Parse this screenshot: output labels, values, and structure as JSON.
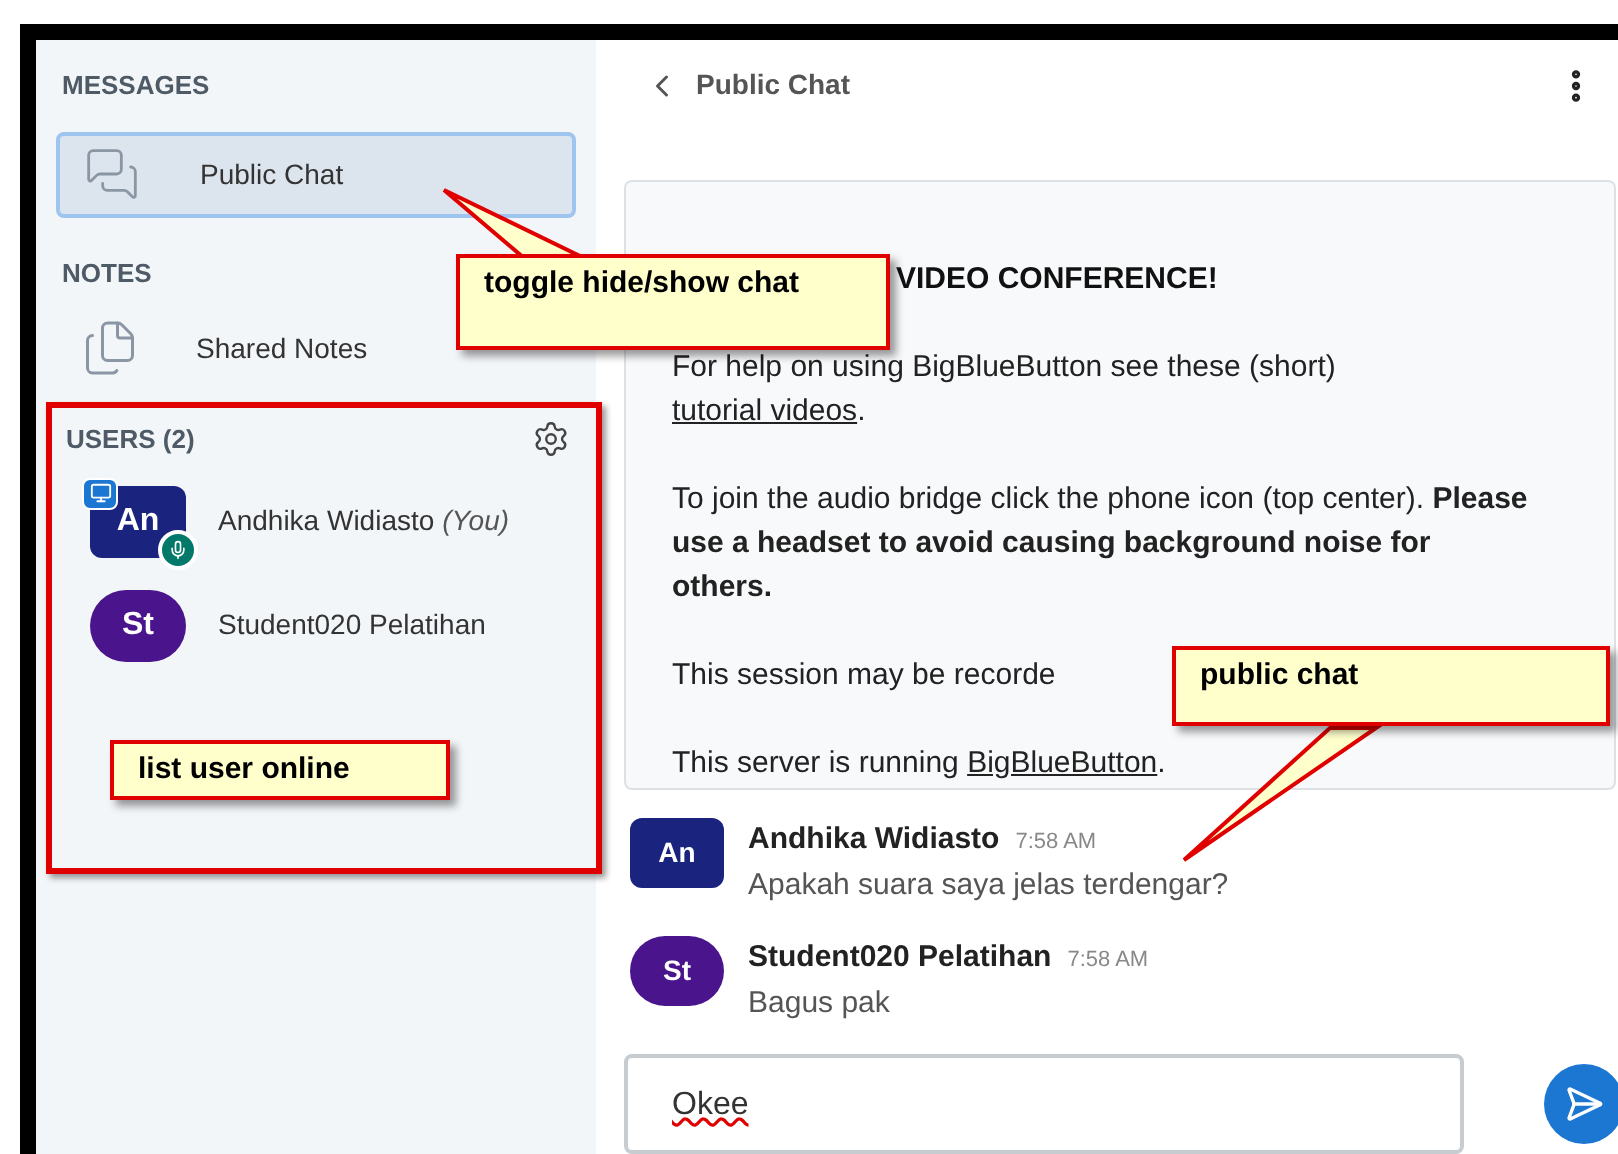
{
  "sidebar": {
    "messages_heading": "MESSAGES",
    "messages": [
      {
        "label": "Public Chat",
        "selected": true
      }
    ],
    "notes_heading": "NOTES",
    "notes": [
      {
        "label": "Shared Notes",
        "selected": false
      }
    ],
    "users_heading": "USERS (2)",
    "users": [
      {
        "initials": "An",
        "name": "Andhika Widiasto",
        "suffix": "(You)",
        "kind": "square",
        "color": "#1a237e",
        "presenter": true,
        "audio": true
      },
      {
        "initials": "St",
        "name": "Student020 Pelatihan",
        "kind": "round",
        "color": "#4a148c",
        "presenter": false,
        "audio": false
      }
    ]
  },
  "chat": {
    "title": "Public Chat",
    "welcome": {
      "title": "VIDEO CONFERENCE!",
      "paragraphs": [
        {
          "parts": [
            {
              "kind": "text",
              "text": "For help on using BigBlueButton see these (short) "
            },
            {
              "kind": "link",
              "text": "tutorial videos"
            },
            {
              "kind": "text",
              "text": "."
            }
          ]
        },
        {
          "parts": [
            {
              "kind": "text",
              "text": "To join the audio bridge click the phone icon (top center). "
            },
            {
              "kind": "bold",
              "text": "Please use a headset to avoid causing background noise for others."
            }
          ]
        },
        {
          "parts": [
            {
              "kind": "text",
              "text": "This session may be recorde"
            }
          ]
        },
        {
          "parts": [
            {
              "kind": "text",
              "text": "This server is running "
            },
            {
              "kind": "link",
              "text": "BigBlueButton"
            },
            {
              "kind": "text",
              "text": "."
            }
          ]
        }
      ]
    },
    "messages": [
      {
        "initials": "An",
        "kind": "square",
        "color": "#1a237e",
        "name": "Andhika Widiasto",
        "time": "7:58 AM",
        "text": "Apakah suara saya jelas terdengar?"
      },
      {
        "initials": "St",
        "kind": "round",
        "color": "#4a148c",
        "name": "Student020 Pelatihan",
        "time": "7:58 AM",
        "text": "Bagus pak"
      }
    ],
    "input": {
      "value": "Okee"
    }
  },
  "annotations": [
    {
      "kind": "toggle",
      "text": "toggle hide/show chat"
    },
    {
      "kind": "users",
      "text": "list user online"
    },
    {
      "kind": "chat",
      "text": "public chat"
    }
  ]
}
